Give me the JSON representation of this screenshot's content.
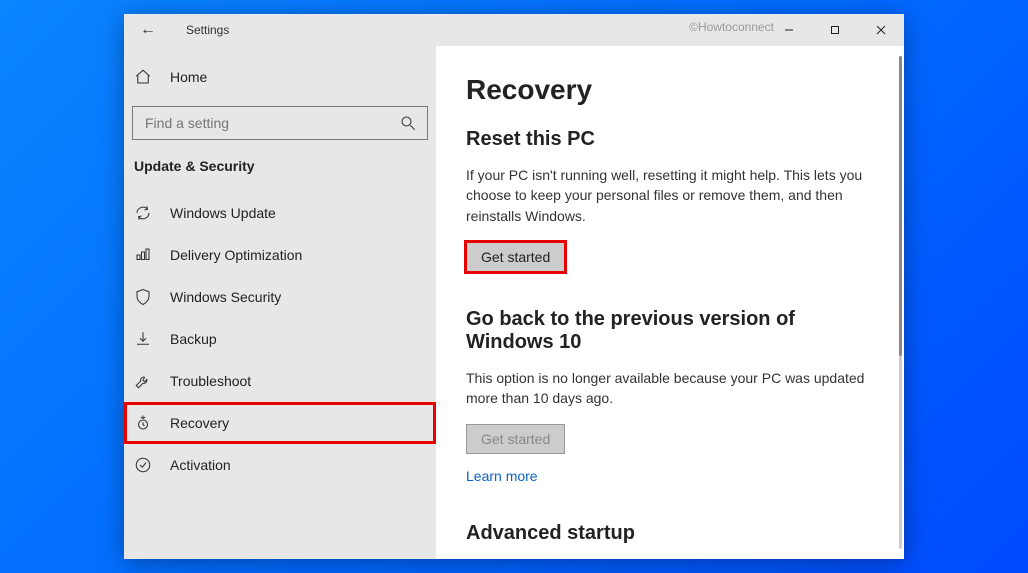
{
  "titlebar": {
    "app": "Settings",
    "watermark": "©Howtoconnect"
  },
  "sidebar": {
    "home": "Home",
    "search_placeholder": "Find a setting",
    "category": "Update & Security",
    "items": [
      {
        "label": "Windows Update"
      },
      {
        "label": "Delivery Optimization"
      },
      {
        "label": "Windows Security"
      },
      {
        "label": "Backup"
      },
      {
        "label": "Troubleshoot"
      },
      {
        "label": "Recovery"
      },
      {
        "label": "Activation"
      }
    ]
  },
  "main": {
    "title": "Recovery",
    "reset": {
      "heading": "Reset this PC",
      "desc": "If your PC isn't running well, resetting it might help. This lets you choose to keep your personal files or remove them, and then reinstalls Windows.",
      "button": "Get started"
    },
    "goback": {
      "heading": "Go back to the previous version of Windows 10",
      "desc": "This option is no longer available because your PC was updated more than 10 days ago.",
      "button": "Get started",
      "link": "Learn more"
    },
    "advanced": {
      "heading": "Advanced startup"
    }
  }
}
